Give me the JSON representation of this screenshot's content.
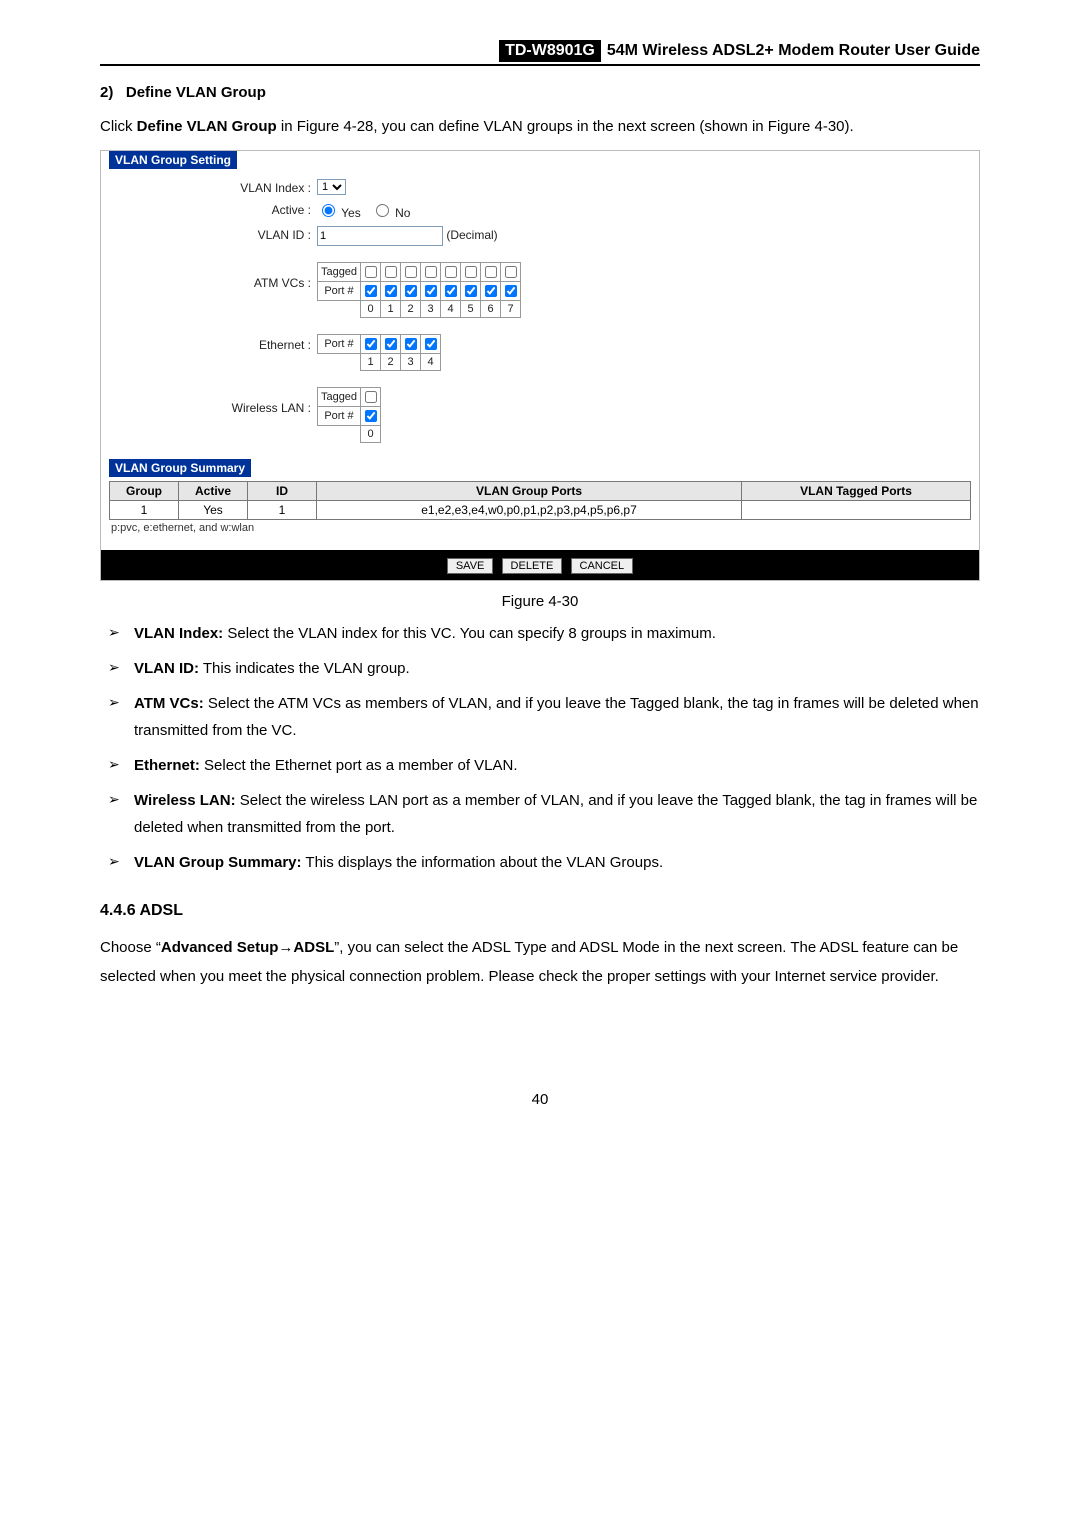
{
  "header": {
    "model": "TD-W8901G",
    "title": "54M Wireless ADSL2+ Modem Router User Guide"
  },
  "section2": {
    "num": "2)",
    "title": "Define VLAN Group"
  },
  "intro": {
    "prefix": "Click ",
    "bold": "Define VLAN Group",
    "rest": " in Figure 4-28, you can define VLAN groups in the next screen (shown in Figure 4-30)."
  },
  "panel": {
    "group_setting_title": "VLAN Group Setting",
    "labels": {
      "vlan_index": "VLAN Index :",
      "active": "Active :",
      "vlan_id": "VLAN ID :",
      "atm_vcs": "ATM VCs :",
      "ethernet": "Ethernet :",
      "wireless": "Wireless LAN :",
      "tagged": "Tagged",
      "port": "Port #",
      "decimal": "(Decimal)"
    },
    "vlan_index_value": "1",
    "active_yes": "Yes",
    "active_no": "No",
    "vlan_id_value": "1",
    "atm": {
      "tagged": [
        false,
        false,
        false,
        false,
        false,
        false,
        false,
        false
      ],
      "port": [
        true,
        true,
        true,
        true,
        true,
        true,
        true,
        true
      ],
      "cols": [
        "0",
        "1",
        "2",
        "3",
        "4",
        "5",
        "6",
        "7"
      ]
    },
    "eth": {
      "port": [
        true,
        true,
        true,
        true
      ],
      "cols": [
        "1",
        "2",
        "3",
        "4"
      ]
    },
    "wlan": {
      "tagged": [
        false
      ],
      "port": [
        true
      ],
      "cols": [
        "0"
      ]
    },
    "summary_title": "VLAN Group Summary",
    "summary": {
      "headers": {
        "group": "Group",
        "active": "Active",
        "id": "ID",
        "ports": "VLAN Group Ports",
        "tagged": "VLAN Tagged Ports"
      },
      "row": {
        "group": "1",
        "active": "Yes",
        "id": "1",
        "ports": "e1,e2,e3,e4,w0,p0,p1,p2,p3,p4,p5,p6,p7",
        "tagged": ""
      },
      "note": "p:pvc, e:ethernet, and w:wlan"
    },
    "buttons": {
      "save": "SAVE",
      "delete": "DELETE",
      "cancel": "CANCEL"
    }
  },
  "figure_caption": "Figure 4-30",
  "bullets": {
    "b1_bold": "VLAN Index:",
    "b1_text": " Select the VLAN index for this VC. You can specify 8 groups in maximum.",
    "b2_bold": "VLAN ID:",
    "b2_text": " This indicates the VLAN group.",
    "b3_bold": "ATM VCs:",
    "b3_text": " Select the ATM VCs as members of VLAN, and if you leave the Tagged blank, the tag in frames will be deleted when transmitted from the VC.",
    "b4_bold": "Ethernet:",
    "b4_text": " Select the Ethernet port as a member of VLAN.",
    "b5_bold": "Wireless LAN:",
    "b5_text": " Select the wireless LAN port as a member of VLAN, and if you leave the Tagged blank, the tag in frames will be deleted when transmitted from the port.",
    "b6_bold": "VLAN Group Summary:",
    "b6_text": " This displays the information about the VLAN Groups."
  },
  "adsl": {
    "heading": "4.4.6  ADSL",
    "p_prefix": "Choose “",
    "p_bold1": "Advanced Setup",
    "p_arrow": "→",
    "p_bold2": "ADSL",
    "p_rest": "”, you can select the ADSL Type and ADSL Mode in the next screen. The ADSL feature can be selected when you meet the physical connection problem. Please check the proper settings with your Internet service provider."
  },
  "page_number": "40"
}
